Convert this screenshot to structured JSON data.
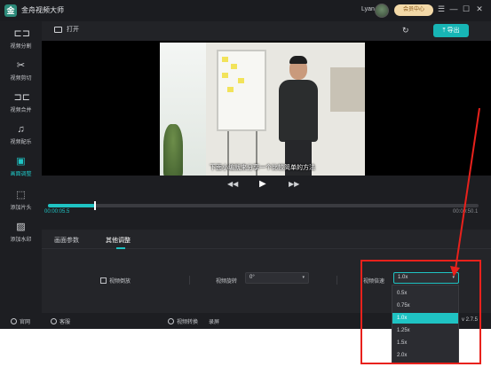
{
  "titlebar": {
    "app_title": "金舟视频大师",
    "logo_glyph": "金",
    "username": "Lyan",
    "vip_label": "会员中心",
    "min_glyph": "—",
    "close_glyph": "✕",
    "menu_glyph": "☰",
    "max_glyph": "☐"
  },
  "sidebar": {
    "items": [
      {
        "label": "视频分割",
        "icon": "split-icon",
        "glyph": "⊏⊐"
      },
      {
        "label": "视频剪切",
        "icon": "scissors-icon",
        "glyph": "✂"
      },
      {
        "label": "视频合并",
        "icon": "merge-icon",
        "glyph": "⊐⊏"
      },
      {
        "label": "视频配乐",
        "icon": "music-icon",
        "glyph": "♫"
      },
      {
        "label": "画面调整",
        "icon": "adjust-icon",
        "glyph": "▣"
      },
      {
        "label": "添加片头",
        "icon": "intro-icon",
        "glyph": "⬚"
      },
      {
        "label": "添加水印",
        "icon": "watermark-icon",
        "glyph": "▨"
      }
    ]
  },
  "toolbar": {
    "open_label": "打开",
    "export_label": "导出",
    "export_glyph": "⤒",
    "refresh_glyph": "↻"
  },
  "video": {
    "subtitle": "下面小编就来分享一个比较简单的方法"
  },
  "controls": {
    "rewind_glyph": "◀◀",
    "play_glyph": "▶",
    "forward_glyph": "▶▶"
  },
  "timeline": {
    "current_time": "00:00:05.5",
    "total_time": "00:00:50.1",
    "progress_fraction": 0.11
  },
  "tabs": [
    {
      "label": "画面参数"
    },
    {
      "label": "其他调整"
    }
  ],
  "settings": {
    "reverse_label": "视频倒放",
    "rotate_label": "视频旋转",
    "rotate_value": "0°",
    "speed_label": "视频倍速",
    "speed_value": "1.0x",
    "caret_glyph": "▾"
  },
  "speed_options": [
    "0.5x",
    "0.75x",
    "1.0x",
    "1.25x",
    "1.5x",
    "2.0x"
  ],
  "footer": {
    "website_label": "官网",
    "service_label": "客服",
    "convert_label": "视频转换",
    "record_label": "录屏",
    "version": "v 2.7.5"
  },
  "colors": {
    "accent": "#1fc3c3",
    "annotation": "#e8211c"
  }
}
